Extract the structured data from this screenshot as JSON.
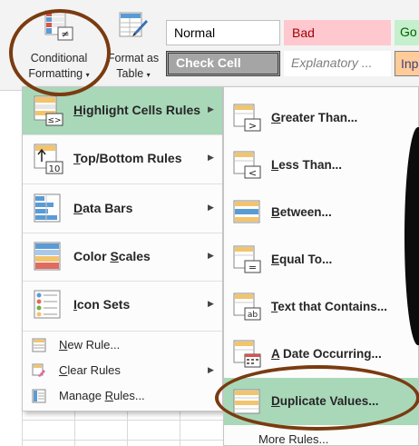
{
  "ribbon": {
    "conditional_formatting": {
      "line1": "Conditional",
      "line2": "Formatting",
      "icon": "conditional-formatting-icon"
    },
    "format_as_table": {
      "line1": "Format as",
      "line2": "Table",
      "icon": "format-as-table-icon"
    },
    "caret": "▾",
    "styles": {
      "normal": "Normal",
      "bad": "Bad",
      "good": "Go",
      "check_cell": "Check Cell",
      "explanatory": "Explanatory ...",
      "input": "Inp"
    }
  },
  "menu": {
    "items": [
      {
        "pre": "",
        "key": "H",
        "post": "ighlight Cells Rules",
        "icon": "highlight-cells-icon",
        "active": true
      },
      {
        "pre": "",
        "key": "T",
        "post": "op/Bottom Rules",
        "icon": "top-bottom-icon"
      },
      {
        "pre": "",
        "key": "D",
        "post": "ata Bars",
        "icon": "data-bars-icon"
      },
      {
        "pre": "Color ",
        "key": "S",
        "post": "cales",
        "icon": "color-scales-icon"
      },
      {
        "pre": "",
        "key": "I",
        "post": "con Sets",
        "icon": "icon-sets-icon"
      }
    ],
    "small_items": [
      {
        "pre": "",
        "key": "N",
        "post": "ew Rule...",
        "icon": "new-rule-icon"
      },
      {
        "pre": "",
        "key": "C",
        "post": "lear Rules",
        "icon": "clear-rules-icon",
        "has_submenu": true
      },
      {
        "pre": "Manage ",
        "key": "R",
        "post": "ules...",
        "icon": "manage-rules-icon"
      }
    ],
    "arrow": "▶"
  },
  "submenu": {
    "items": [
      {
        "pre": "",
        "key": "G",
        "post": "reater Than...",
        "icon": "greater-than-icon",
        "glyph": ">"
      },
      {
        "pre": "",
        "key": "L",
        "post": "ess Than...",
        "icon": "less-than-icon",
        "glyph": "<"
      },
      {
        "pre": "",
        "key": "B",
        "post": "etween...",
        "icon": "between-icon",
        "glyph": ""
      },
      {
        "pre": "",
        "key": "E",
        "post": "qual To...",
        "icon": "equal-to-icon",
        "glyph": "="
      },
      {
        "pre": "",
        "key": "T",
        "post": "ext that Contains...",
        "icon": "text-contains-icon",
        "glyph": "ab"
      },
      {
        "pre": "",
        "key": "A",
        "post": " Date Occurring...",
        "icon": "date-occurring-icon",
        "glyph": ""
      },
      {
        "pre": "",
        "key": "D",
        "post": "uplicate Values...",
        "icon": "duplicate-values-icon",
        "glyph": "",
        "active": true
      }
    ],
    "more_rules": "More Rules..."
  },
  "colors": {
    "active_highlight": "#a9d8b9",
    "annotation_ring": "#7a3b10"
  }
}
